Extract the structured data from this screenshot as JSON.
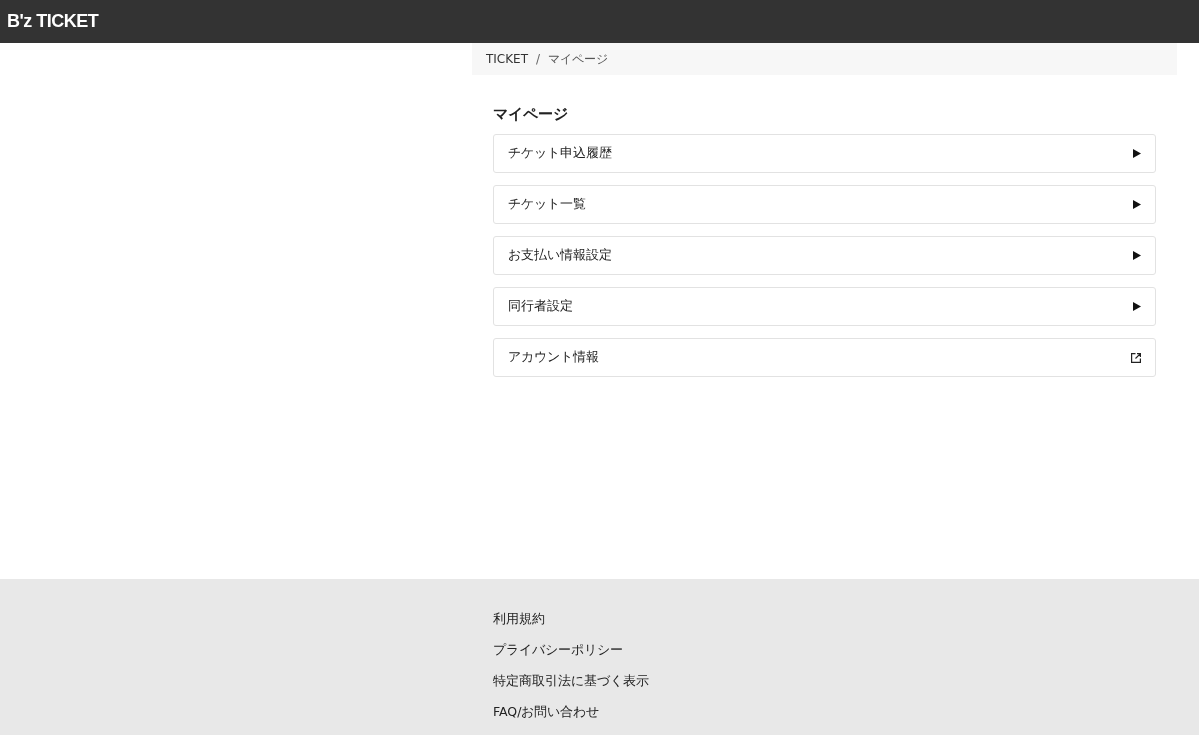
{
  "header": {
    "logo": "B'z TICKET"
  },
  "breadcrumb": [
    "TICKET",
    "マイページ"
  ],
  "breadcrumb_separator": "/",
  "page_title": "マイページ",
  "menu": [
    {
      "label": "チケット申込履歴",
      "kind": "arrow"
    },
    {
      "label": "チケット一覧",
      "kind": "arrow"
    },
    {
      "label": "お支払い情報設定",
      "kind": "arrow"
    },
    {
      "label": "同行者設定",
      "kind": "arrow"
    },
    {
      "label": "アカウント情報",
      "kind": "external"
    }
  ],
  "footer_links": [
    "利用規約",
    "プライバシーポリシー",
    "特定商取引法に基づく表示",
    "FAQ/お問い合わせ"
  ]
}
